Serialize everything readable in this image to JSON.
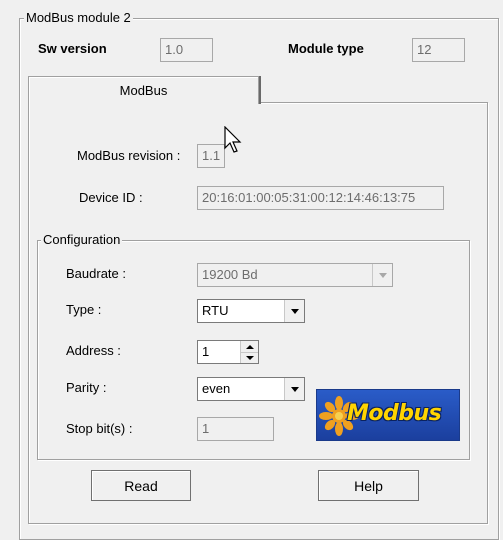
{
  "module": {
    "title": "ModBus module 2",
    "sw_version_label": "Sw version",
    "sw_version_value": "1.0",
    "module_type_label": "Module type",
    "module_type_value": "12"
  },
  "tabs": [
    {
      "label": "ModBus",
      "active": true
    }
  ],
  "modbus": {
    "revision_label": "ModBus revision :",
    "revision_value": "1.1",
    "device_id_label": "Device ID :",
    "device_id_value": "20:16:01:00:05:31:00:12:14:46:13:75"
  },
  "configuration": {
    "title": "Configuration",
    "baudrate_label": "Baudrate :",
    "baudrate_value": "19200 Bd",
    "type_label": "Type :",
    "type_value": "RTU",
    "address_label": "Address :",
    "address_value": "1",
    "parity_label": "Parity :",
    "parity_value": "even",
    "stopbits_label": "Stop bit(s) :",
    "stopbits_value": "1"
  },
  "logo": {
    "text": "Modbus",
    "icon": "modbus-logo"
  },
  "buttons": {
    "read": "Read",
    "help": "Help"
  },
  "colors": {
    "logo_bg": "#2454c0",
    "logo_text": "#ffd400",
    "logo_star": "#f0a020"
  }
}
